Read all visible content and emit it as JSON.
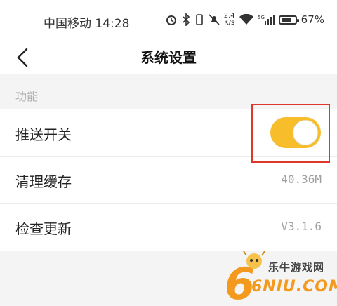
{
  "status_bar": {
    "carrier_time": "中国移动 14:28",
    "net_speed_value": "2.4",
    "net_speed_unit": "K/s",
    "battery": "67%",
    "icons": [
      "alarm-icon",
      "bluetooth-icon",
      "vibrate-icon",
      "mute-icon",
      "wifi-icon",
      "signal-5g-icon",
      "battery-icon"
    ]
  },
  "header": {
    "title": "系统设置",
    "back_icon": "chevron-left-icon"
  },
  "section": {
    "label": "功能"
  },
  "settings": {
    "push": {
      "label": "推送开关",
      "enabled": true,
      "toggle_color": "#f7bd2b"
    },
    "cache": {
      "label": "清理缓存",
      "value": "40.36M"
    },
    "update": {
      "label": "检查更新",
      "value": "V3.1.6"
    }
  },
  "watermark": {
    "name": "乐牛游戏网",
    "domain": "6NIU.COM"
  },
  "colors": {
    "accent": "#f7bd2b",
    "highlight": "#e0372c"
  }
}
